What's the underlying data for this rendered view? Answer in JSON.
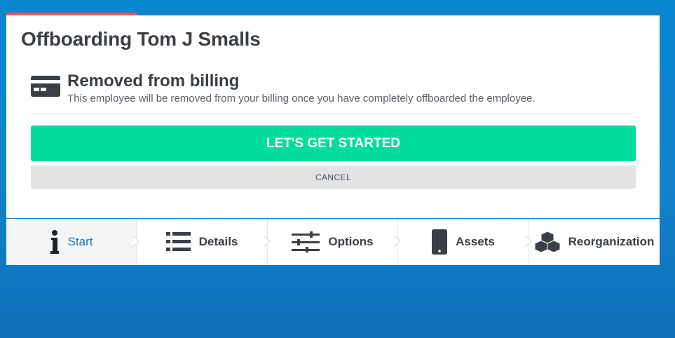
{
  "modal": {
    "title": "Offboarding Tom J Smalls",
    "billing": {
      "icon": "credit-card-icon",
      "title": "Removed from billing",
      "description": "This employee will be removed from your billing once you have completely offboarded the employee."
    },
    "start_button": "LET'S GET STARTED",
    "cancel_button": "CANCEL"
  },
  "steps": [
    {
      "label": "Start",
      "icon": "info-icon",
      "active": true
    },
    {
      "label": "Details",
      "icon": "list-icon",
      "active": false
    },
    {
      "label": "Options",
      "icon": "sliders-icon",
      "active": false
    },
    {
      "label": "Assets",
      "icon": "phone-icon",
      "active": false
    },
    {
      "label": "Reorganization",
      "icon": "cubes-icon",
      "active": false
    }
  ],
  "colors": {
    "background": "#0a86cf",
    "accent_bar": "#e8545d",
    "primary_button": "#00dc9c",
    "active_step_text": "#1a73c2"
  }
}
